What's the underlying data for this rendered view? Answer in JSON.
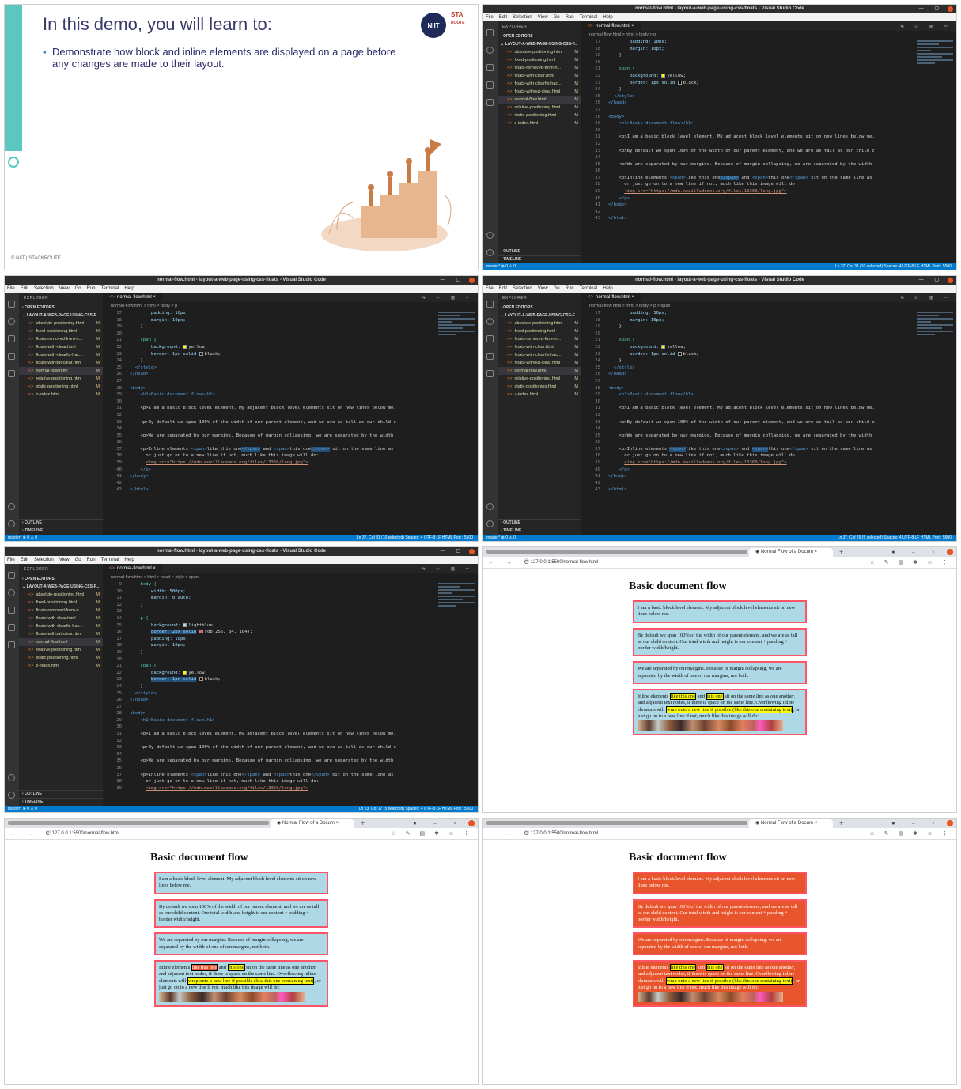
{
  "slide": {
    "title": "In this demo, you will learn to:",
    "bullet": "Demonstrate how block and inline elements are displayed on a page before any changes are made to their layout.",
    "logo_left": "NIIT",
    "logo_right_top": "STA",
    "logo_right_bottom": "ROUTE",
    "copyright": "© NIIT | STACKROUTE"
  },
  "vscode": {
    "window_title": "normal-flow.html - layout-a-web-page-using-css-floats - Visual Studio Code",
    "menu": [
      "File",
      "Edit",
      "Selection",
      "View",
      "Go",
      "Run",
      "Terminal",
      "Help"
    ],
    "explorer_label": "EXPLORER",
    "open_editors": "OPEN EDITORS",
    "project": "LAYOUT-A-WEB-PAGE-USING-CSS-F...",
    "files": [
      "absolute-positioning.html",
      "fixed-positioning.html",
      "floats-removed-from-n...",
      "floats-with-clear.html",
      "floats-with-clearfix-hac...",
      "floats-without-clear.html",
      "normal-flow.html",
      "relative-positioning.html",
      "static-positioning.html",
      "z-index.html"
    ],
    "file_marker": "M",
    "outline": "OUTLINE",
    "timeline": "TIMELINE",
    "tab": "normal-flow.html",
    "tab_close": "×",
    "breadcrumb_p": "normal-flow.html > html > body > p",
    "breadcrumb_span": "normal-flow.html > html > body > p > span",
    "breadcrumb_style": "normal-flow.html > html > head > style > span",
    "status_left": "master*   ⊗ 0 ⚠ 0",
    "status_right_1": "Ln 37, Col 31 (10 selected)   Spaces: 4   UTF-8   LF   HTML   Port : 5500",
    "status_right_2": "Ln 37, Col 29 (5 selected)   Spaces: 4   UTF-8   LF   HTML   Port : 5500",
    "status_right_3": "Ln 23, Col 17 (5 selected)   Spaces: 4   UTF-8   LF   HTML   Port : 5500"
  },
  "code": {
    "l17": "padding: 10px;",
    "l18": "margin: 10px;",
    "l19": "}",
    "l21": "span {",
    "l22a": "background:",
    "l22b": "yellow;",
    "l23a": "border: 1px solid",
    "l23b": "black;",
    "l24": "}",
    "l25": "</style>",
    "l26": "</head>",
    "l28": "<body>",
    "l29": "<h1>Basic document flow</h1>",
    "l31": "<p>I am a basic block level element. My adjacent block level elements sit on new lines below me.",
    "l33": "<p>By default we span 100% of the width of our parent element, and we are as tall as our child c",
    "l35": "<p>We are separated by our margins. Because of margin collapsing, we are separated by the width",
    "l37a": "<p>Inline elements",
    "l37b": "<span>",
    "l37c": "like this one",
    "l37d": "</span>",
    "l37e": "and",
    "l37f": "this one",
    "l37g": "sit on the same line as",
    "l38": "or just go on to a new line if not, much like this image will do:",
    "l39": "<img src=\"https://mdn.mozillademos.org/files/13360/long.jpg\">",
    "l40": "</p>",
    "l41": "</body>",
    "l43": "</html>",
    "l9": "body {",
    "l10": "width: 500px;",
    "l11": "margin: 0 auto;",
    "l12": "}",
    "l14": "p {",
    "l15a": "background:",
    "l15b": "lightblue;",
    "l16a": "border: 2px solid",
    "l16b": "rgb(255, 84, 104);"
  },
  "browser": {
    "tab_title": "Normal Flow of a Docum",
    "url": "127.0.0.1:5500/normal-flow.html",
    "heading": "Basic document flow",
    "p1": "I am a basic block level element. My adjacent block level elements sit on new lines below me.",
    "p2": "By default we span 100% of the width of our parent element, and we are as tall as our child content. Our total width and height is our content + padding + border width/height.",
    "p3": "We are separated by our margins. Because of margin collapsing, we are separated by the width of one of our margins, not both.",
    "p4a": "Inline elements",
    "p4b": "like this one",
    "p4c": "and",
    "p4d": "this one",
    "p4e": "sit on the same line as one another, and adjacent text nodes, if there is space on the same line. Overflowing inline elements will",
    "p4f": "wrap onto a new line if possible (like this one containing text)",
    "p4g": ", or just go on to a new line if not, much like this image will do:"
  },
  "colors": {
    "accent_teal": "#5cc7c0",
    "vscode_blue": "#007acc",
    "para_bg": "#add8e6",
    "para_border": "rgb(255,84,104)",
    "span_bg": "yellow"
  }
}
